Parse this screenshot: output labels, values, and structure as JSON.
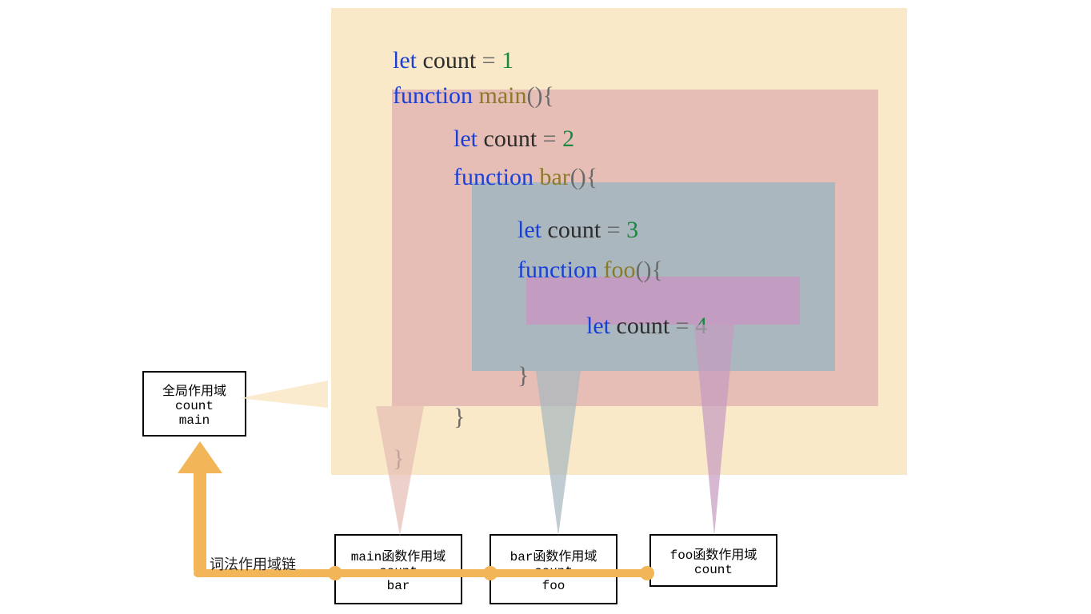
{
  "code": {
    "l1_let": "let",
    "l1_var": " count ",
    "l1_eq": "= ",
    "l1_num": "1",
    "l2_func": "function",
    "l2_name": " main",
    "l2_paren": "(){",
    "l3_let": "let",
    "l3_var": " count ",
    "l3_eq": "= ",
    "l3_num": "2",
    "l4_func": "function",
    "l4_name": " bar",
    "l4_paren": "(){",
    "l5_let": "let",
    "l5_var": " count ",
    "l5_eq": "= ",
    "l5_num": "3",
    "l6_func": "function",
    "l6_name": " foo",
    "l6_paren": "(){",
    "l7_let": "let",
    "l7_var": " count ",
    "l7_eq": "= ",
    "l7_num": "4",
    "l8_close": "}",
    "l9_close": "}",
    "l10_close": "}"
  },
  "boxes": {
    "global": {
      "title": "全局作用域",
      "v1": "count",
      "v2": "main"
    },
    "main": {
      "title": "main函数作用域",
      "v1": "count",
      "v2": "bar"
    },
    "bar": {
      "title": "bar函数作用域",
      "v1": "count",
      "v2": "foo"
    },
    "foo": {
      "title": "foo函数作用域",
      "v1": "count"
    }
  },
  "labels": {
    "chain": "词法作用域链"
  }
}
